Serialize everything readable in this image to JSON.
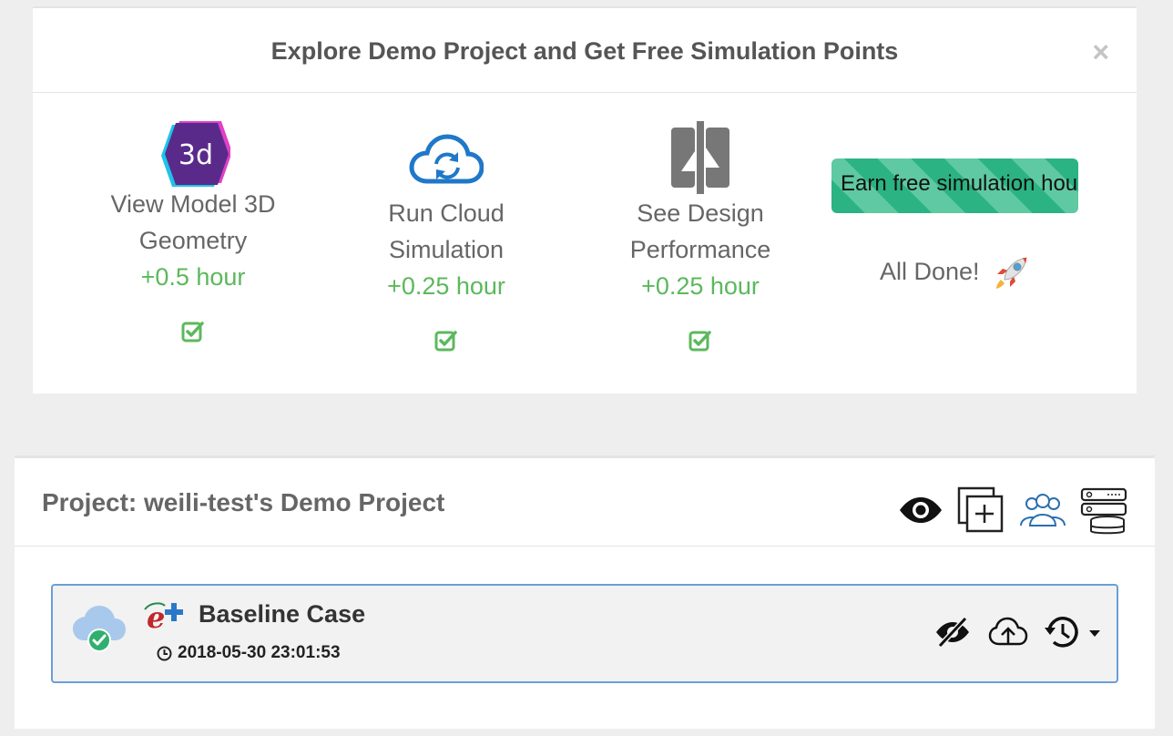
{
  "demo": {
    "title": "Explore Demo Project and Get Free Simulation Points",
    "close_label": "×",
    "steps": [
      {
        "label_line1": "View Model 3D",
        "label_line2": "Geometry",
        "reward": "+0.5 hour",
        "icon": "3d-hexagon-icon",
        "completed": true
      },
      {
        "label_line1": "Run Cloud",
        "label_line2": "Simulation",
        "reward": "+0.25 hour",
        "icon": "cloud-sync-icon",
        "completed": true
      },
      {
        "label_line1": "See Design",
        "label_line2": "Performance",
        "reward": "+0.25 hour",
        "icon": "compare-panels-icon",
        "completed": true
      }
    ],
    "icon_3d_text": "3d",
    "earn_button_label": "Earn free simulation hours",
    "all_done_label": "All Done!",
    "colors": {
      "success": "#5cb85c",
      "cloud_blue": "#1f78c8",
      "earn_stripe_dark": "#2bb384",
      "earn_stripe_light": "#5ec9a2"
    }
  },
  "project": {
    "title": "Project: weili-test's Demo Project",
    "toolbar": [
      "eye-icon",
      "add-copy-icon",
      "users-icon",
      "server-database-icon"
    ],
    "case": {
      "name": "Baseline Case",
      "timestamp": "2018-05-30 23:01:53",
      "status": "completed",
      "engine_icon": "energyplus-logo-icon",
      "actions": [
        "eye-slash-icon",
        "cloud-upload-icon",
        "history-dropdown-icon"
      ]
    },
    "colors": {
      "card_border": "#6a9fd8",
      "cloud": "#a9c9ec",
      "status_check": "#2fb06e"
    }
  }
}
